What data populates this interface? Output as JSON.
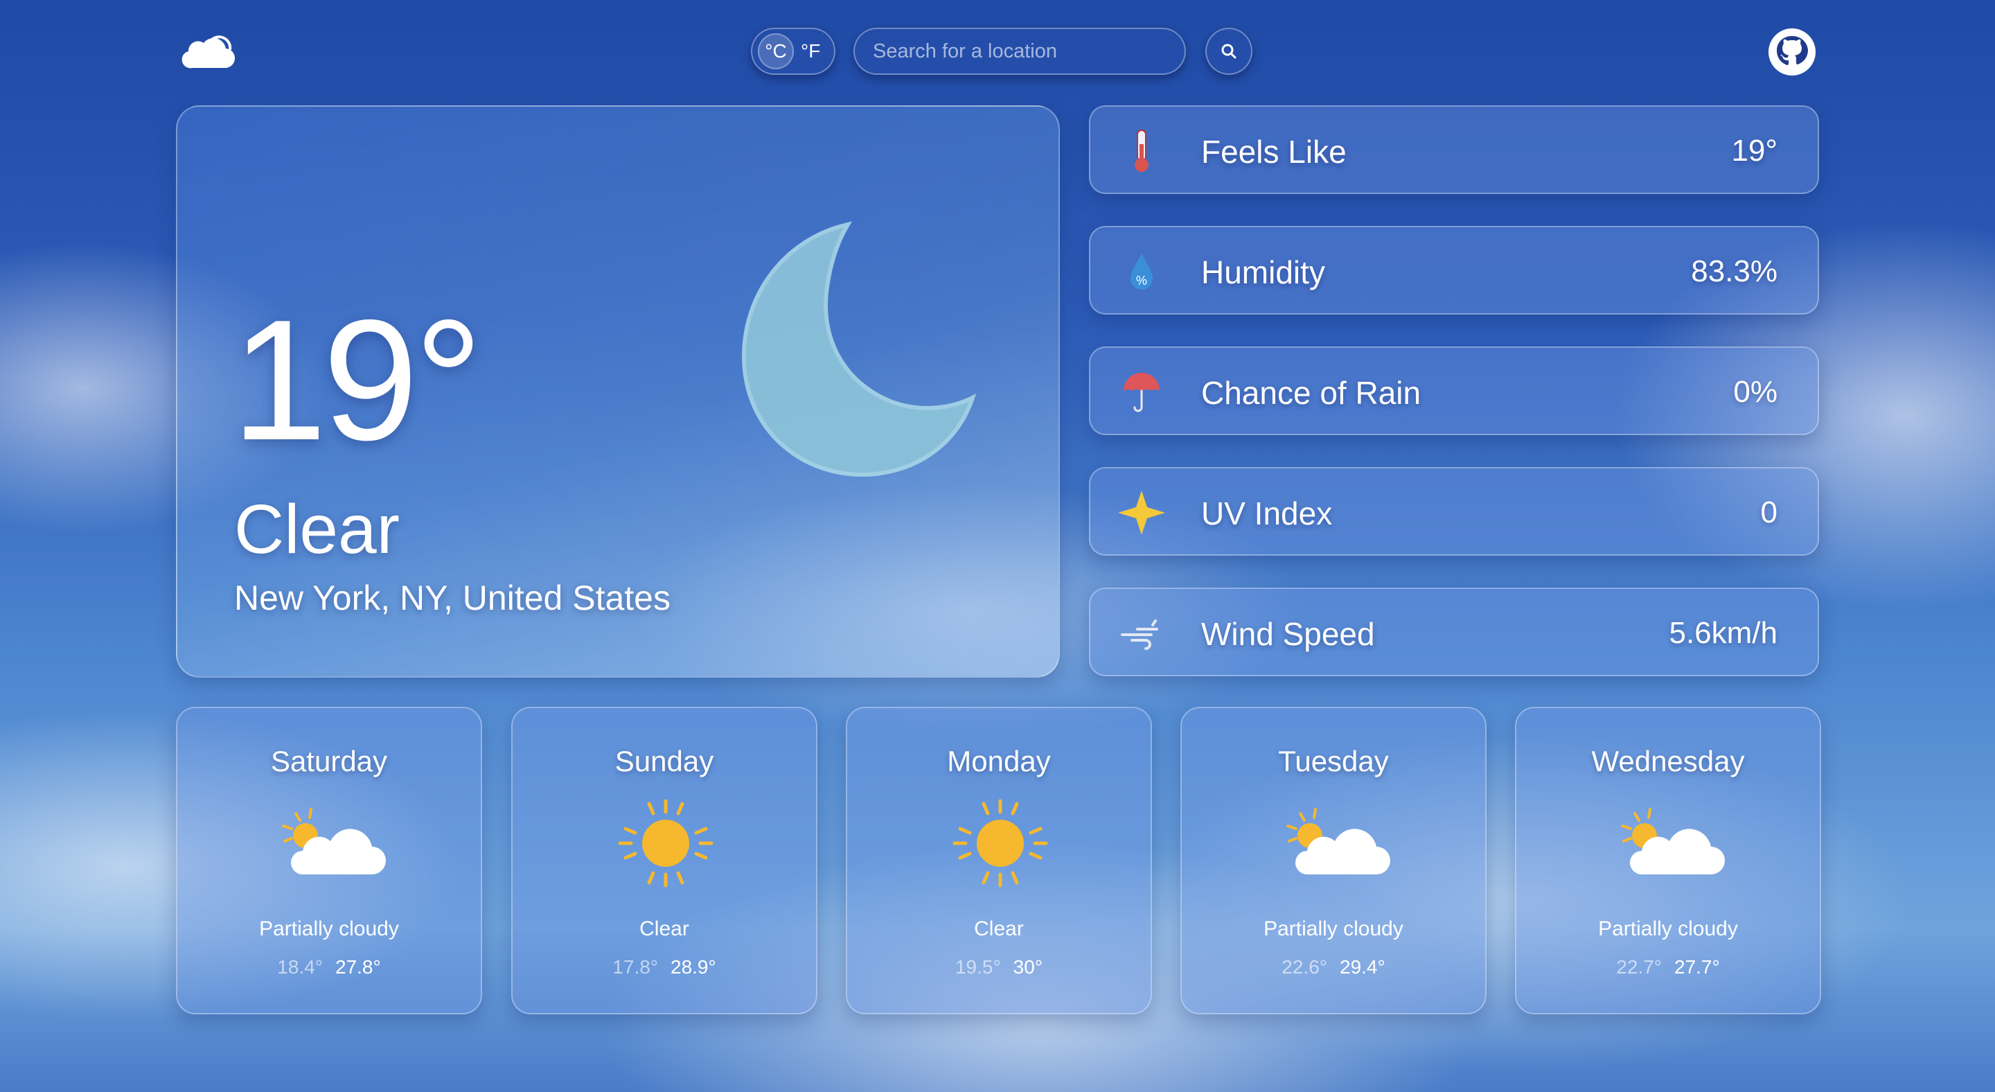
{
  "header": {
    "logo_icon": "cloud-logo-icon",
    "unit_celsius": "°C",
    "unit_fahrenheit": "°F",
    "search_placeholder": "Search for a location",
    "search_icon": "search-icon",
    "github_icon": "github-icon"
  },
  "current": {
    "temperature": "19°",
    "condition": "Clear",
    "location": "New York, NY, United States",
    "icon": "moon-icon"
  },
  "stats": [
    {
      "label": "Feels Like",
      "value": "19°",
      "icon": "thermometer-icon"
    },
    {
      "label": "Humidity",
      "value": "83.3%",
      "icon": "humidity-drop-icon"
    },
    {
      "label": "Chance of Rain",
      "value": "0%",
      "icon": "umbrella-icon"
    },
    {
      "label": "UV Index",
      "value": "0",
      "icon": "uv-star-icon"
    },
    {
      "label": "Wind Speed",
      "value": "5.6km/h",
      "icon": "wind-icon"
    }
  ],
  "forecast": [
    {
      "day": "Saturday",
      "condition": "Partially cloudy",
      "low": "18.4°",
      "high": "27.8°",
      "icon": "partly-cloudy-icon"
    },
    {
      "day": "Sunday",
      "condition": "Clear",
      "low": "17.8°",
      "high": "28.9°",
      "icon": "sun-icon"
    },
    {
      "day": "Monday",
      "condition": "Clear",
      "low": "19.5°",
      "high": "30°",
      "icon": "sun-icon"
    },
    {
      "day": "Tuesday",
      "condition": "Partially cloudy",
      "low": "22.6°",
      "high": "29.4°",
      "icon": "partly-cloudy-icon"
    },
    {
      "day": "Wednesday",
      "condition": "Partially cloudy",
      "low": "22.7°",
      "high": "27.7°",
      "icon": "partly-cloudy-icon"
    }
  ],
  "colors": {
    "sun": "#f5b82e",
    "moon": "#8cc3d9",
    "umbrella": "#e0555a",
    "thermometer": "#d9534f",
    "drop": "#3b8fd9"
  }
}
